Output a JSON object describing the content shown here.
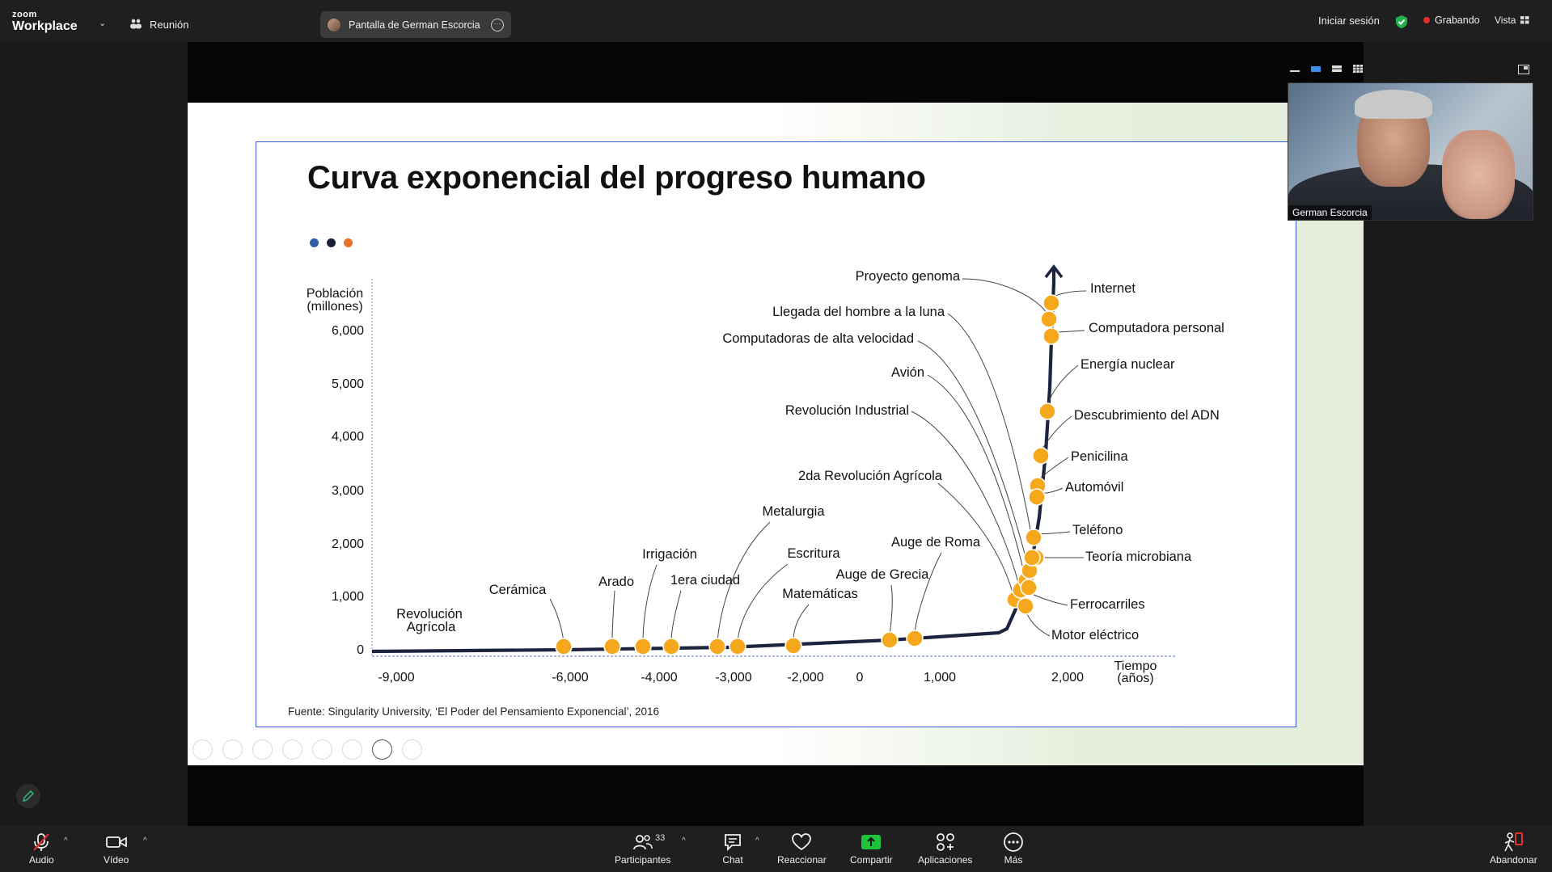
{
  "topbar": {
    "brand_small": "zoom",
    "brand_large": "Workplace",
    "meeting_label": "Reunión",
    "screen_share_label": "Pantalla de German Escorcia",
    "signin": "Iniciar sesión",
    "recording": "Grabando",
    "view": "Vista"
  },
  "slide": {
    "title": "Curva exponencial del progreso humano",
    "dot_colors": [
      "#2e5ea8",
      "#1a1f3a",
      "#e8712b"
    ],
    "source": "Fuente: Singularity University, ‘El Poder del Pensamiento Exponencial’, 2016"
  },
  "chart_data": {
    "type": "line",
    "ylabel": "Población (millones)",
    "xlabel": "Tiempo (años)",
    "x_ticks": [
      "-9,000",
      "-6,000",
      "-4,000",
      "-3,000",
      "-2,000",
      "0",
      "1,000",
      "2,000"
    ],
    "y_ticks": [
      "0",
      "1,000",
      "2,000",
      "3,000",
      "4,000",
      "5,000",
      "6,000"
    ],
    "ylim": [
      0,
      6500
    ],
    "line_color": "#1c2440",
    "marker_color": "#f5a81c",
    "events": [
      {
        "label": "Revolución Agrícola"
      },
      {
        "label": "Cerámica"
      },
      {
        "label": "Arado"
      },
      {
        "label": "Irrigación"
      },
      {
        "label": "1era ciudad"
      },
      {
        "label": "Metalurgia"
      },
      {
        "label": "Escritura"
      },
      {
        "label": "Matemáticas"
      },
      {
        "label": "Auge de Grecia"
      },
      {
        "label": "Auge de Roma"
      },
      {
        "label": "2da Revolución Agrícola"
      },
      {
        "label": "Revolución Industrial"
      },
      {
        "label": "Avión"
      },
      {
        "label": "Computadoras de alta velocidad"
      },
      {
        "label": "Llegada del hombre a la luna"
      },
      {
        "label": "Proyecto genoma"
      },
      {
        "label": "Internet"
      },
      {
        "label": "Computadora personal"
      },
      {
        "label": "Energía nuclear"
      },
      {
        "label": "Descubrimiento del ADN"
      },
      {
        "label": "Penicilina"
      },
      {
        "label": "Automóvil"
      },
      {
        "label": "Teléfono"
      },
      {
        "label": "Teoría microbiana"
      },
      {
        "label": "Ferrocarriles"
      },
      {
        "label": "Motor eléctrico"
      }
    ]
  },
  "video": {
    "participant_name": "German Escorcia"
  },
  "toolbar": {
    "audio": "Audio",
    "video": "Vídeo",
    "participants": "Participantes",
    "participants_count": "33",
    "chat": "Chat",
    "react": "Reaccionar",
    "share": "Compartir",
    "apps": "Aplicaciones",
    "more": "Más",
    "leave": "Abandonar",
    "share_color": "#1ec33c",
    "leave_color": "#e0312b"
  }
}
